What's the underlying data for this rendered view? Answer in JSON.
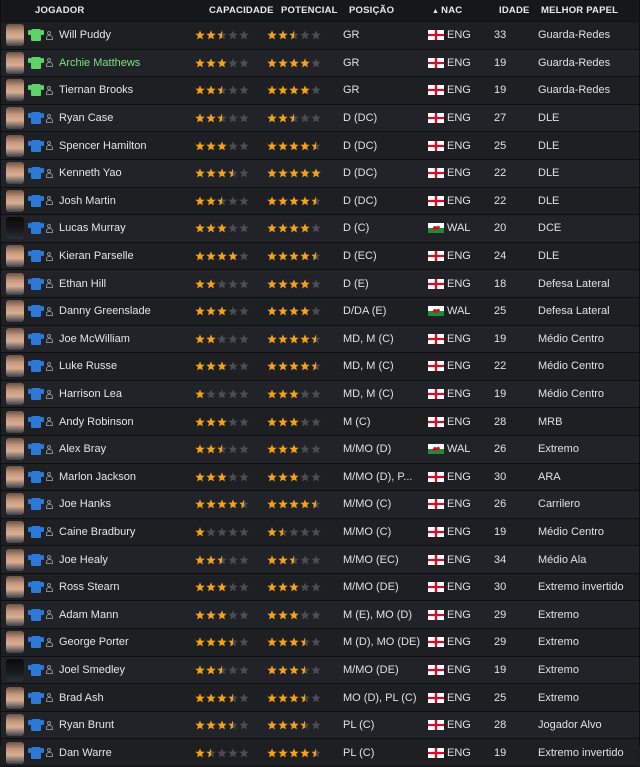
{
  "header": {
    "jogador": "JOGADOR",
    "capacidade": "CAPACIDADE",
    "potencial": "POTENCIAL",
    "posicao": "POSIÇÃO",
    "nac": "NAC",
    "idade": "IDADE",
    "melhor_papel": "MELHOR PAPEL"
  },
  "colors": {
    "star": "#f4a21c",
    "star_empty": "#4a4d54",
    "gk_shirt": "#5fd36a",
    "outfield_shirt": "#2c79d8",
    "highlight_name": "#7be37f"
  },
  "players": [
    {
      "name": "Will Puddy",
      "shirt": "gk",
      "cap": 2.5,
      "pot": 2.5,
      "pos": "GR",
      "nat": "ENG",
      "age": "33",
      "role": "Guarda-Redes"
    },
    {
      "name": "Archie Matthews",
      "shirt": "gk",
      "highlight": true,
      "cap": 3,
      "pot": 4,
      "pos": "GR",
      "nat": "ENG",
      "age": "19",
      "role": "Guarda-Redes"
    },
    {
      "name": "Tiernan Brooks",
      "shirt": "gk",
      "cap": 2.5,
      "pot": 4,
      "pos": "GR",
      "nat": "ENG",
      "age": "19",
      "role": "Guarda-Redes"
    },
    {
      "name": "Ryan Case",
      "shirt": "out",
      "cap": 2.5,
      "pot": 2.5,
      "pos": "D (DC)",
      "nat": "ENG",
      "age": "27",
      "role": "DLE"
    },
    {
      "name": "Spencer Hamilton",
      "shirt": "out",
      "cap": 3,
      "pot": 4.5,
      "pos": "D (DC)",
      "nat": "ENG",
      "age": "25",
      "role": "DLE"
    },
    {
      "name": "Kenneth Yao",
      "shirt": "out",
      "cap": 3.5,
      "pot": 5,
      "pos": "D (DC)",
      "nat": "ENG",
      "age": "22",
      "role": "DLE"
    },
    {
      "name": "Josh Martin",
      "shirt": "out",
      "cap": 2.5,
      "pot": 4.5,
      "pos": "D (DC)",
      "nat": "ENG",
      "age": "22",
      "role": "DLE"
    },
    {
      "name": "Lucas Murray",
      "shirt": "out",
      "dark": true,
      "cap": 3,
      "pot": 4,
      "pos": "D (C)",
      "nat": "WAL",
      "age": "20",
      "role": "DCE"
    },
    {
      "name": "Kieran Parselle",
      "shirt": "out",
      "cap": 4,
      "pot": 4.5,
      "pos": "D (EC)",
      "nat": "ENG",
      "age": "24",
      "role": "DLE"
    },
    {
      "name": "Ethan Hill",
      "shirt": "out",
      "cap": 2,
      "pot": 4,
      "pos": "D (E)",
      "nat": "ENG",
      "age": "18",
      "role": "Defesa Lateral"
    },
    {
      "name": "Danny Greenslade",
      "shirt": "out",
      "cap": 3,
      "pot": 4,
      "pos": "D/DA (E)",
      "nat": "WAL",
      "age": "25",
      "role": "Defesa Lateral"
    },
    {
      "name": "Joe McWilliam",
      "shirt": "out",
      "cap": 2,
      "pot": 4.5,
      "pos": "MD, M (C)",
      "nat": "ENG",
      "age": "19",
      "role": "Médio Centro"
    },
    {
      "name": "Luke Russe",
      "shirt": "out",
      "cap": 3,
      "pot": 4.5,
      "pos": "MD, M (C)",
      "nat": "ENG",
      "age": "22",
      "role": "Médio Centro"
    },
    {
      "name": "Harrison Lea",
      "shirt": "out",
      "cap": 1,
      "pot": 3,
      "pos": "MD, M (C)",
      "nat": "ENG",
      "age": "19",
      "role": "Médio Centro"
    },
    {
      "name": "Andy Robinson",
      "shirt": "out",
      "cap": 3,
      "pot": 3,
      "pos": "M (C)",
      "nat": "ENG",
      "age": "28",
      "role": "MRB"
    },
    {
      "name": "Alex Bray",
      "shirt": "out",
      "cap": 2.5,
      "pot": 3,
      "pos": "M/MO (D)",
      "nat": "WAL",
      "age": "26",
      "role": "Extremo"
    },
    {
      "name": "Marlon Jackson",
      "shirt": "out",
      "cap": 3,
      "pot": 3,
      "pos": "M/MO (D), P...",
      "nat": "ENG",
      "age": "30",
      "role": "ARA"
    },
    {
      "name": "Joe Hanks",
      "shirt": "out",
      "cap": 4.5,
      "pot": 4.5,
      "pos": "M/MO (C)",
      "nat": "ENG",
      "age": "26",
      "role": "Carrilero"
    },
    {
      "name": "Caine Bradbury",
      "shirt": "out",
      "cap": 1,
      "pot": 1.5,
      "pos": "M/MO (C)",
      "nat": "ENG",
      "age": "19",
      "role": "Médio Centro"
    },
    {
      "name": "Joe Healy",
      "shirt": "out",
      "cap": 2.5,
      "pot": 2.5,
      "pos": "M/MO (EC)",
      "nat": "ENG",
      "age": "34",
      "role": "Médio Ala"
    },
    {
      "name": "Ross Stearn",
      "shirt": "out",
      "cap": 3,
      "pot": 3,
      "pos": "M/MO (DE)",
      "nat": "ENG",
      "age": "30",
      "role": "Extremo invertido"
    },
    {
      "name": "Adam Mann",
      "shirt": "out",
      "cap": 3,
      "pot": 3,
      "pos": "M (E), MO (D)",
      "nat": "ENG",
      "age": "29",
      "role": "Extremo"
    },
    {
      "name": "George Porter",
      "shirt": "out",
      "cap": 3.5,
      "pot": 3.5,
      "pos": "M (D), MO (DE)",
      "nat": "ENG",
      "age": "29",
      "role": "Extremo"
    },
    {
      "name": "Joel Smedley",
      "shirt": "out",
      "dark": true,
      "cap": 2.5,
      "pot": 3.5,
      "pos": "M/MO (DE)",
      "nat": "ENG",
      "age": "19",
      "role": "Extremo"
    },
    {
      "name": "Brad Ash",
      "shirt": "out",
      "cap": 3.5,
      "pot": 3.5,
      "pos": "MO (D), PL (C)",
      "nat": "ENG",
      "age": "25",
      "role": "Extremo"
    },
    {
      "name": "Ryan Brunt",
      "shirt": "out",
      "cap": 3.5,
      "pot": 3.5,
      "pos": "PL (C)",
      "nat": "ENG",
      "age": "28",
      "role": "Jogador Alvo"
    },
    {
      "name": "Dan Warre",
      "shirt": "out",
      "cap": 1.5,
      "pot": 4.5,
      "pos": "PL (C)",
      "nat": "ENG",
      "age": "19",
      "role": "Extremo invertido"
    }
  ]
}
